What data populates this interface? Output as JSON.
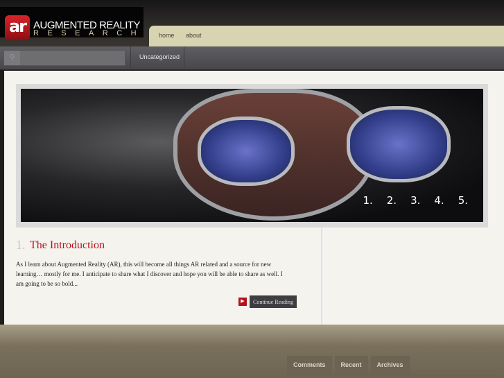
{
  "logo": {
    "mark": "ar",
    "line1": "AUGMENTED REALITY",
    "line2": "RESEARCH"
  },
  "nav": {
    "items": [
      "home",
      "about"
    ]
  },
  "menubar": {
    "search_placeholder": "",
    "search_icon": "search-icon",
    "categories": [
      "Uncategorized"
    ]
  },
  "slider": {
    "pager": [
      "1.",
      "2.",
      "3.",
      "4.",
      "5."
    ]
  },
  "post": {
    "number": "1.",
    "title": "The Introduction",
    "excerpt": "As I learn about Augmented Reality (AR), this will become all things AR related and a source for new learning… mostly for me. I anticipate to share what I discover and hope you will be able to share as well. I am going to be so bold...",
    "more_label": "Continue Reading"
  },
  "widget_tabs": [
    "Comments",
    "Recent",
    "Archives"
  ],
  "colors": {
    "accent": "#b5121b",
    "nav_tab": "#d8d3b0",
    "menubar": "#525256"
  }
}
